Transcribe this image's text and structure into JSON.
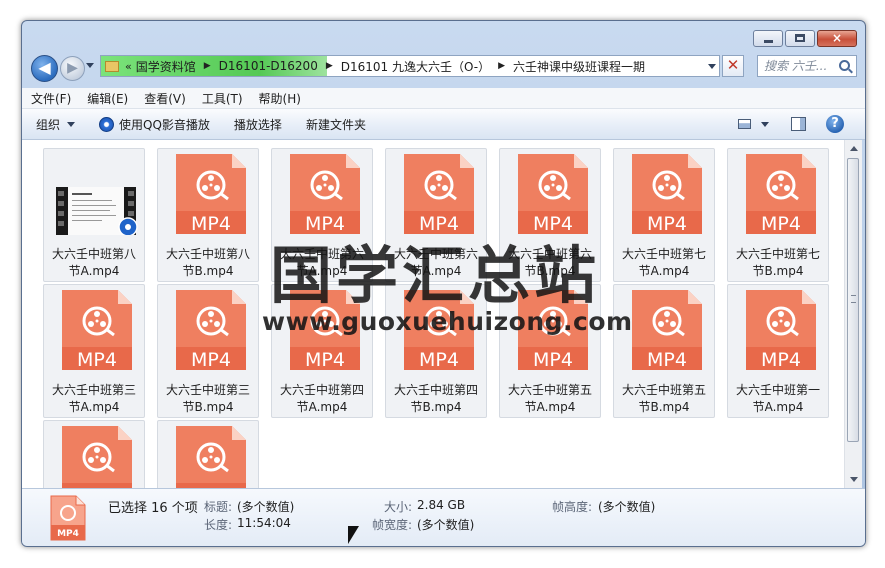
{
  "window": {
    "caption_close": "×"
  },
  "address": {
    "chevron": "«",
    "crumbs": [
      "国学资料馆",
      "D16101-D16200",
      "D16101 九逸大六壬（O-）",
      "六壬神课中级班课程一期"
    ],
    "separator": "▶",
    "refresh_glyph": "✕"
  },
  "search": {
    "placeholder": "搜索 六壬..."
  },
  "menu": [
    "文件(F)",
    "编辑(E)",
    "查看(V)",
    "工具(T)",
    "帮助(H)"
  ],
  "commands": {
    "organize": "组织",
    "play_qq": "使用QQ影音播放",
    "play_selection": "播放选择",
    "new_folder": "新建文件夹",
    "help_glyph": "?"
  },
  "mp4_badge": "MP4",
  "files": [
    {
      "line1": "大六壬中班第八",
      "line2": "节A.mp4",
      "thumb": "video-frame"
    },
    {
      "line1": "大六壬中班第八",
      "line2": "节B.mp4",
      "thumb": "mp4"
    },
    {
      "line1": "大六壬中班第六",
      "line2": "节A.mp4",
      "thumb": "mp4"
    },
    {
      "line1": "大六壬中班第六",
      "line2": "节A.mp4",
      "thumb": "mp4"
    },
    {
      "line1": "大六壬中班第六",
      "line2": "节B.mp4",
      "thumb": "mp4"
    },
    {
      "line1": "大六壬中班第七",
      "line2": "节A.mp4",
      "thumb": "mp4"
    },
    {
      "line1": "大六壬中班第七",
      "line2": "节B.mp4",
      "thumb": "mp4"
    },
    {
      "line1": "大六壬中班第三",
      "line2": "节A.mp4",
      "thumb": "mp4"
    },
    {
      "line1": "大六壬中班第三",
      "line2": "节B.mp4",
      "thumb": "mp4"
    },
    {
      "line1": "大六壬中班第四",
      "line2": "节A.mp4",
      "thumb": "mp4"
    },
    {
      "line1": "大六壬中班第四",
      "line2": "节B.mp4",
      "thumb": "mp4"
    },
    {
      "line1": "大六壬中班第五",
      "line2": "节A.mp4",
      "thumb": "mp4"
    },
    {
      "line1": "大六壬中班第五",
      "line2": "节B.mp4",
      "thumb": "mp4"
    },
    {
      "line1": "大六壬中班第一",
      "line2": "节A.mp4",
      "thumb": "mp4"
    },
    {
      "line1": "",
      "line2": "",
      "thumb": "mp4"
    },
    {
      "line1": "",
      "line2": "",
      "thumb": "mp4"
    }
  ],
  "details": {
    "selected": "已选择 16 个项",
    "title_key": "标题:",
    "title_val": "(多个数值)",
    "length_key": "长度:",
    "length_val": "11:54:04",
    "size_key": "大小:",
    "size_val": "2.84 GB",
    "framewidth_key": "帧宽度:",
    "framewidth_val": "(多个数值)",
    "frameheight_key": "帧高度:",
    "frameheight_val": "(多个数值)",
    "icon_badge": "MP4"
  },
  "watermark": {
    "text": "国学汇总站",
    "url": "www.guoxuehuizong.com"
  },
  "colors": {
    "mp4_orange": "#ef7f60",
    "mp4_badge_orange": "#e8694a",
    "address_green": "#55c955"
  }
}
